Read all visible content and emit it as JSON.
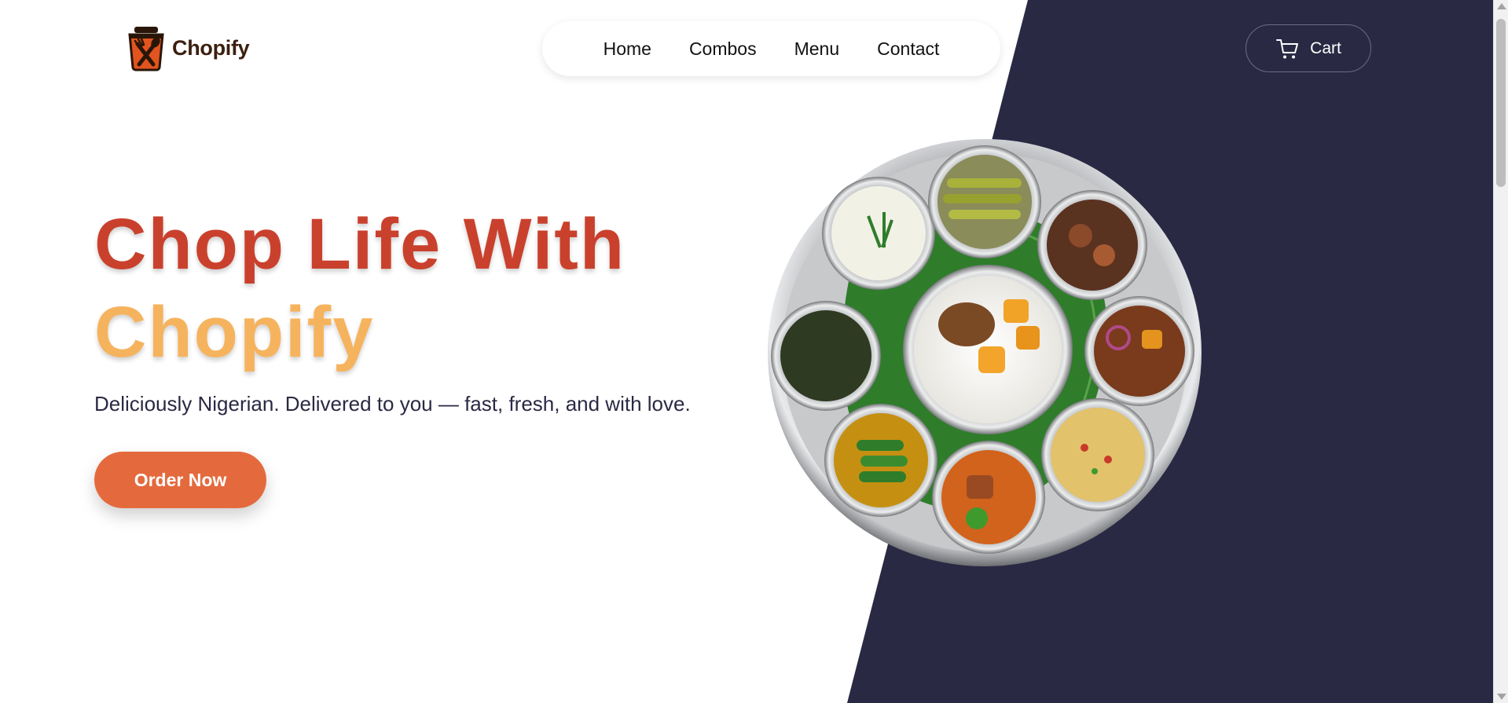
{
  "brand": {
    "name": "Chopify",
    "logo_icon": "bag-fork-spoon-icon"
  },
  "nav": {
    "items": [
      {
        "label": "Home"
      },
      {
        "label": "Combos"
      },
      {
        "label": "Menu"
      },
      {
        "label": "Contact"
      }
    ]
  },
  "cart": {
    "label": "Cart",
    "icon": "cart-icon"
  },
  "hero": {
    "title_line_1": "Chop Life With",
    "title_line_2": "Chopify",
    "tagline": "Deliciously Nigerian. Delivered to you — fast, fresh, and with love.",
    "cta_label": "Order Now",
    "image": "food-platter-image"
  },
  "colors": {
    "accent_red": "#c9412d",
    "accent_yellow": "#f6b35e",
    "cta_orange": "#e46a3e",
    "dark_panel": "#2a2944"
  }
}
